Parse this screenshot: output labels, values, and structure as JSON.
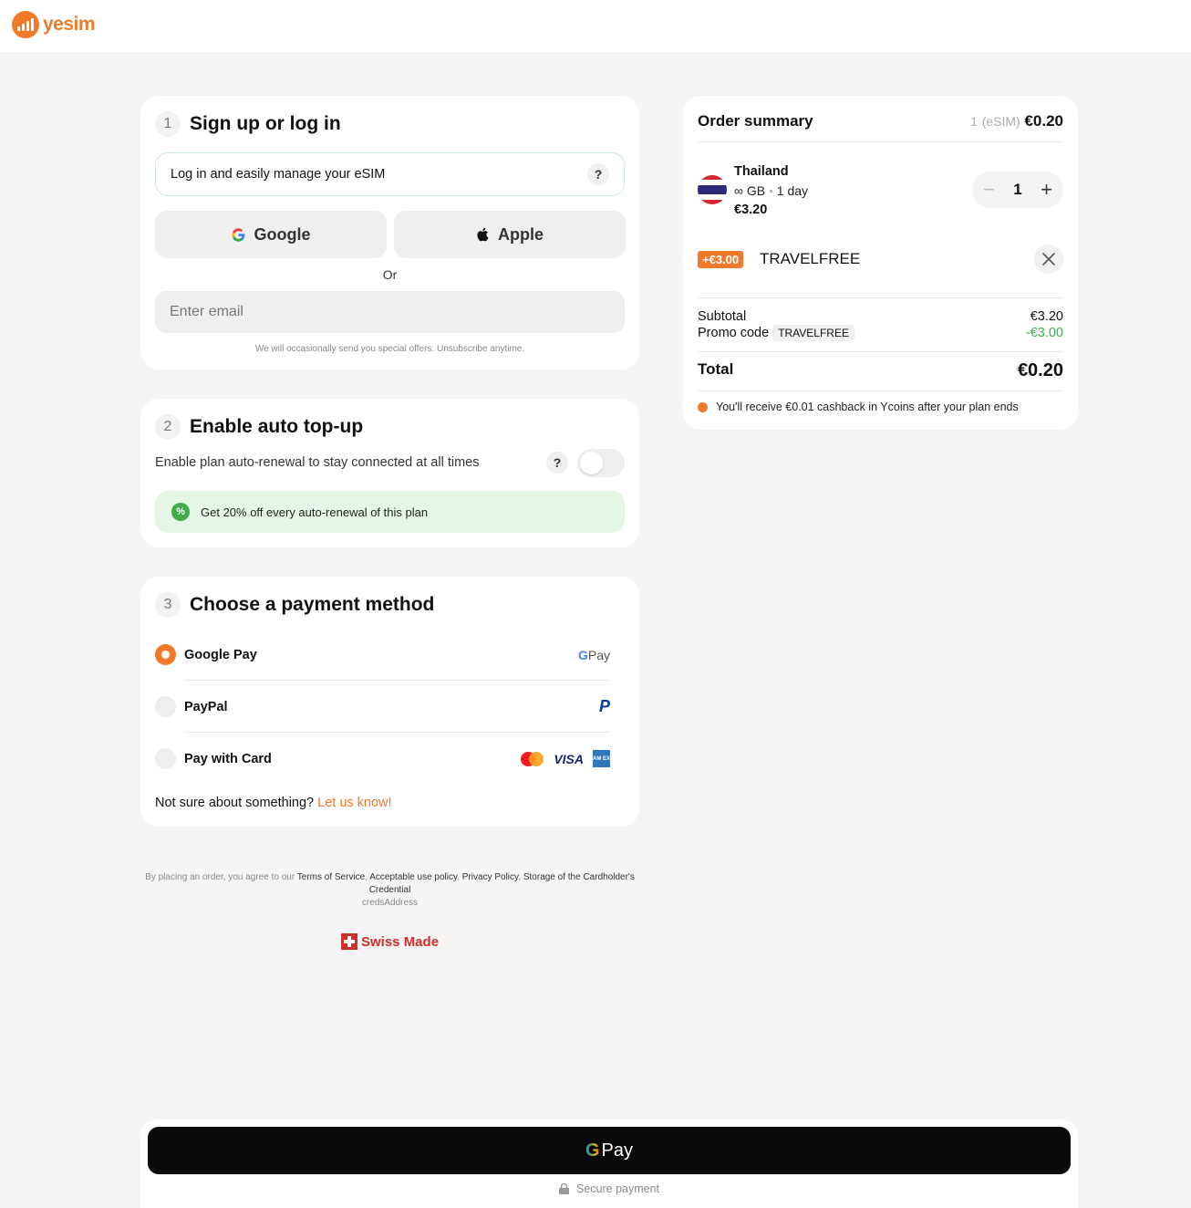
{
  "brand": {
    "name": "yesim",
    "color": "#f17a2a"
  },
  "signup": {
    "step": "1",
    "title": "Sign up or log in",
    "info_text": "Log in and easily manage your eSIM",
    "help_mark": "?",
    "google_label": "Google",
    "apple_label": "Apple",
    "or_text": "Or",
    "email_placeholder": "Enter email",
    "fine_print": "We will occasionally send you special offers. Unsubscribe anytime."
  },
  "autotopup": {
    "step": "2",
    "title": "Enable auto top-up",
    "description": "Enable plan auto-renewal to stay connected at all times",
    "help_mark": "?",
    "toggle_on": false,
    "promo_text": "Get 20% off every auto-renewal of this plan",
    "promo_badge": "%"
  },
  "payment": {
    "step": "3",
    "title": "Choose a payment method",
    "methods": [
      {
        "label": "Google Pay",
        "selected": true,
        "brand": "G Pay"
      },
      {
        "label": "PayPal",
        "selected": false,
        "brand": "P"
      },
      {
        "label": "Pay with Card",
        "selected": false,
        "brand": "VISA"
      }
    ],
    "amex_text": "AM EX",
    "help_text": "Not sure about something?",
    "help_link": "Let us know!"
  },
  "legal": {
    "prefix": "By placing an order, you agree to our",
    "links": [
      "Terms of Service",
      "Acceptable use policy",
      "Privacy Policy",
      "Storage of the Cardholder's Credential"
    ],
    "creds": "credsAddress",
    "swiss": "Swiss Made"
  },
  "order": {
    "title": "Order summary",
    "count_prefix": "1",
    "count_unit": "(eSIM)",
    "total_header": "€0.20",
    "item": {
      "country": "Thailand",
      "data": "∞ GB",
      "sep": "•",
      "duration": "1 day",
      "price": "€3.20",
      "qty": "1",
      "minus": "−",
      "plus": "+"
    },
    "promo": {
      "tag": "+€3.00",
      "code": "TRAVELFREE"
    },
    "subtotal_label": "Subtotal",
    "subtotal_value": "€3.20",
    "promo_label": "Promo code",
    "promo_code_chip": "TRAVELFREE",
    "promo_value": "-€3.00",
    "total_label": "Total",
    "total_value": "€0.20",
    "cashback": "You'll receive €0.01 cashback in Ycoins after your plan ends"
  },
  "checkout": {
    "button_g": "G",
    "button_text": "Pay",
    "secure_text": "Secure payment"
  },
  "colors": {
    "accent": "#f17a2a",
    "success": "#3fae4a",
    "button_dark": "#0a0a0a"
  }
}
